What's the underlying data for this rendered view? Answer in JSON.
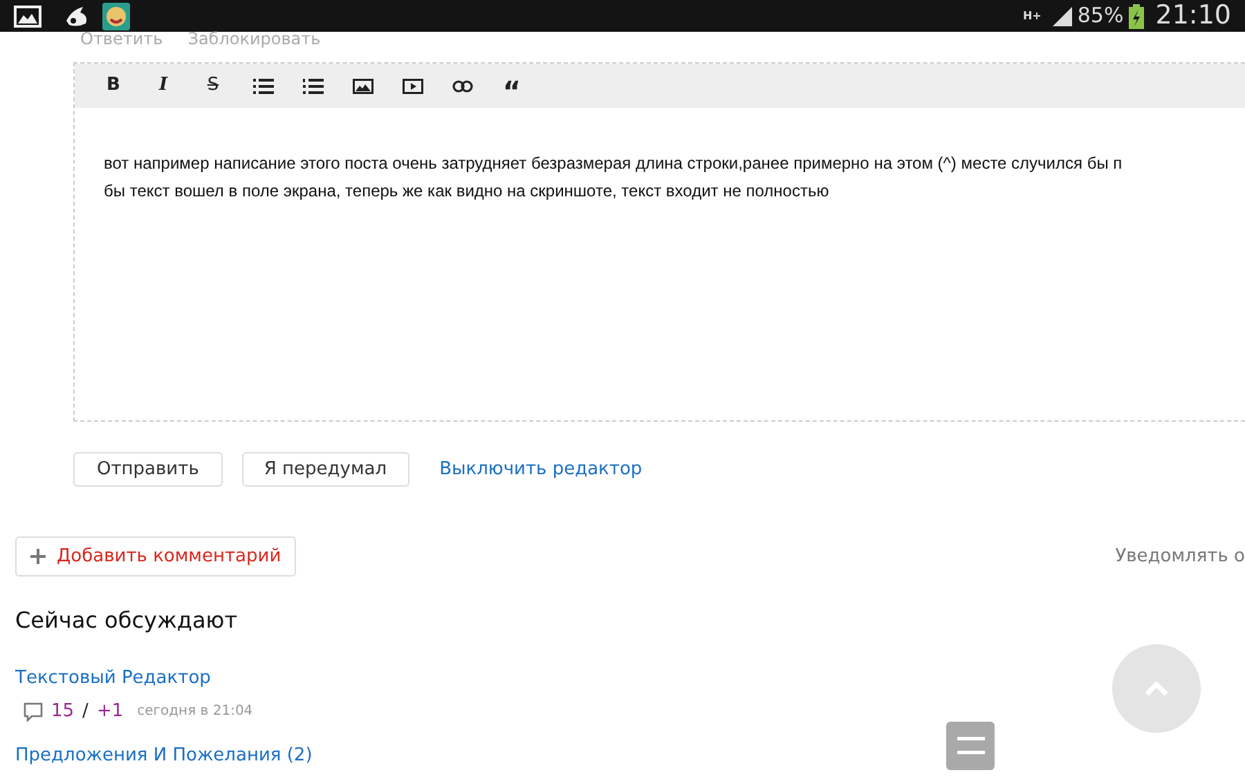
{
  "status_bar": {
    "signal_type": "H+",
    "battery": "85%",
    "time": "21:10"
  },
  "comment_actions": [
    "Ответить",
    "Заблокировать"
  ],
  "editor": {
    "toolbar": [
      {
        "kind": "bold",
        "label": "B"
      },
      {
        "kind": "italic",
        "label": "I"
      },
      {
        "kind": "strike",
        "label": "S"
      },
      {
        "kind": "bullets"
      },
      {
        "kind": "numbers"
      },
      {
        "kind": "image"
      },
      {
        "kind": "video"
      },
      {
        "kind": "link"
      },
      {
        "kind": "quote",
        "label": "“"
      }
    ],
    "lines": [
      "вот например написание этого поста очень затрудняет безразмерая длина строки,ранее примерно на этом (^) месте случился бы п",
      "бы текст вошел в поле экрана, теперь же как видно на скриншоте, текст входит не полностью"
    ]
  },
  "buttons": [
    "Отправить",
    "Я передумал"
  ],
  "disable_editor_link": "Выключить редактор",
  "add_comment": "Добавить комментарий",
  "notify": "Уведомлять о",
  "discussions": {
    "title": "Сейчас обсуждают",
    "items": [
      {
        "title": "Текстовый Редактор",
        "comments": "15",
        "separator": "/",
        "new": "+1",
        "time": "сегодня в 21:04"
      },
      {
        "title": "Предложения И Пожелания (2)"
      }
    ]
  }
}
